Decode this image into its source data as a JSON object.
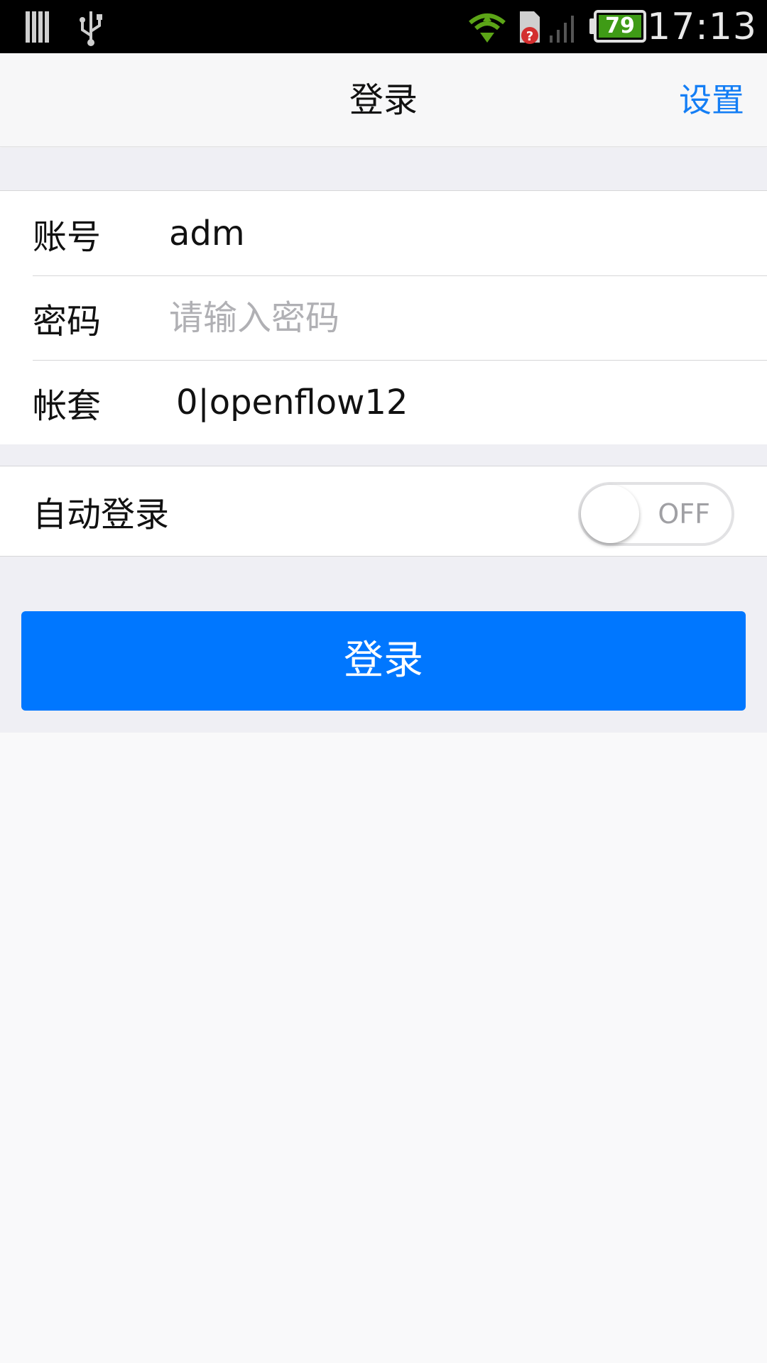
{
  "status_bar": {
    "time": "17:13",
    "battery_level": "79",
    "icons": [
      "notification-bars-icon",
      "usb-icon",
      "wifi-icon",
      "sim-unknown-icon",
      "signal-icon",
      "battery-icon"
    ]
  },
  "nav": {
    "title": "登录",
    "settings_label": "设置"
  },
  "form": {
    "account": {
      "label": "账号",
      "value": "adm"
    },
    "password": {
      "label": "密码",
      "placeholder": "请输入密码",
      "value": ""
    },
    "ledger": {
      "label": "帐套",
      "value": "0|openflow12"
    }
  },
  "auto_login": {
    "label": "自动登录",
    "state": "OFF"
  },
  "login_button": {
    "label": "登录",
    "color": "#0077ff"
  },
  "colors": {
    "accent": "#147ef5",
    "battery": "#3f9b16"
  }
}
